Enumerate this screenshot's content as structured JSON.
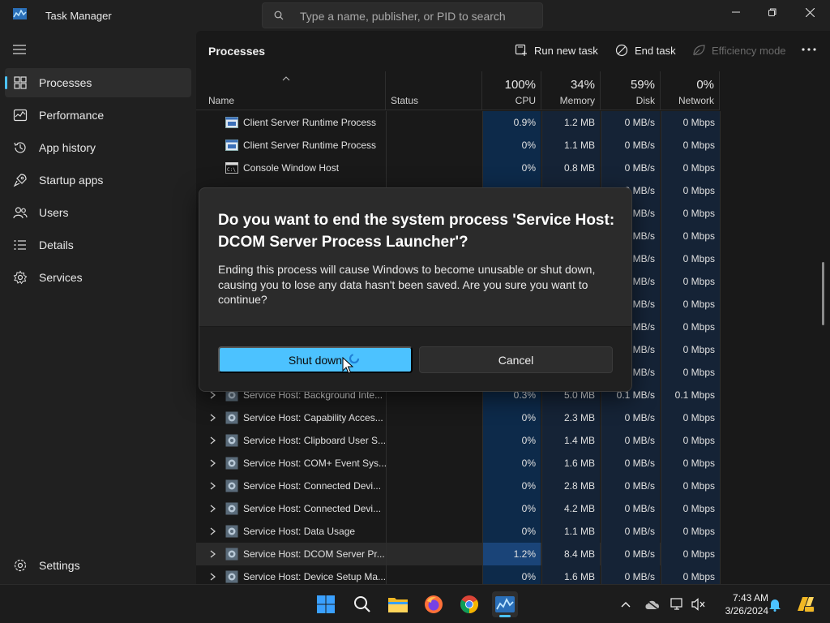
{
  "window": {
    "title": "Task Manager",
    "search_placeholder": "Type a name, publisher, or PID to search"
  },
  "sidebar": {
    "items": [
      {
        "label": "Processes",
        "icon": "processes-icon",
        "active": true
      },
      {
        "label": "Performance",
        "icon": "performance-icon"
      },
      {
        "label": "App history",
        "icon": "app-history-icon"
      },
      {
        "label": "Startup apps",
        "icon": "startup-apps-icon"
      },
      {
        "label": "Users",
        "icon": "users-icon"
      },
      {
        "label": "Details",
        "icon": "details-icon"
      },
      {
        "label": "Services",
        "icon": "services-icon"
      }
    ],
    "settings": "Settings"
  },
  "toolbar": {
    "title": "Processes",
    "run_new_task": "Run new task",
    "end_task": "End task",
    "efficiency_mode": "Efficiency mode"
  },
  "table": {
    "columns": {
      "name": "Name",
      "status": "Status",
      "cpu": {
        "pct": "100%",
        "label": "CPU"
      },
      "memory": {
        "pct": "34%",
        "label": "Memory"
      },
      "disk": {
        "pct": "59%",
        "label": "Disk"
      },
      "network": {
        "pct": "0%",
        "label": "Network"
      }
    },
    "rows": [
      {
        "name": "Client Server Runtime Process",
        "cpu": "0.9%",
        "mem": "1.2 MB",
        "disk": "0 MB/s",
        "net": "0 Mbps",
        "indent": true,
        "icon": "window-icon"
      },
      {
        "name": "Client Server Runtime Process",
        "cpu": "0%",
        "mem": "1.1 MB",
        "disk": "0 MB/s",
        "net": "0 Mbps",
        "indent": true,
        "icon": "window-icon"
      },
      {
        "name": "Console Window Host",
        "cpu": "0%",
        "mem": "0.8 MB",
        "disk": "0 MB/s",
        "net": "0 Mbps",
        "indent": true,
        "icon": "console-icon"
      },
      {
        "name": "",
        "cpu": "",
        "mem": "",
        "disk": "0 MB/s",
        "net": "0 Mbps"
      },
      {
        "name": "",
        "cpu": "",
        "mem": "",
        "disk": "0 MB/s",
        "net": "0 Mbps"
      },
      {
        "name": "",
        "cpu": "",
        "mem": "",
        "disk": "0 MB/s",
        "net": "0 Mbps"
      },
      {
        "name": "",
        "cpu": "",
        "mem": "",
        "disk": "0 MB/s",
        "net": "0 Mbps"
      },
      {
        "name": "",
        "cpu": "",
        "mem": "",
        "disk": "0 MB/s",
        "net": "0 Mbps"
      },
      {
        "name": "",
        "cpu": "",
        "mem": "",
        "disk": "0 MB/s",
        "net": "0 Mbps"
      },
      {
        "name": "",
        "cpu": "",
        "mem": "",
        "disk": "0 MB/s",
        "net": "0 Mbps"
      },
      {
        "name": "",
        "cpu": "",
        "mem": "",
        "disk": "0 MB/s",
        "net": "0 Mbps"
      },
      {
        "name": "",
        "cpu": "",
        "mem": "",
        "disk": "0 MB/s",
        "net": "0 Mbps"
      },
      {
        "name": "Service Host: Background Inte...",
        "cpu": "0.3%",
        "mem": "5.0 MB",
        "disk": "0.1 MB/s",
        "net": "0.1 Mbps",
        "expand": true,
        "icon": "gear-icon"
      },
      {
        "name": "Service Host: Capability Acces...",
        "cpu": "0%",
        "mem": "2.3 MB",
        "disk": "0 MB/s",
        "net": "0 Mbps",
        "expand": true,
        "icon": "gear-icon"
      },
      {
        "name": "Service Host: Clipboard User S...",
        "cpu": "0%",
        "mem": "1.4 MB",
        "disk": "0 MB/s",
        "net": "0 Mbps",
        "expand": true,
        "icon": "gear-icon"
      },
      {
        "name": "Service Host: COM+ Event Sys...",
        "cpu": "0%",
        "mem": "1.6 MB",
        "disk": "0 MB/s",
        "net": "0 Mbps",
        "expand": true,
        "icon": "gear-icon"
      },
      {
        "name": "Service Host: Connected Devi...",
        "cpu": "0%",
        "mem": "2.8 MB",
        "disk": "0 MB/s",
        "net": "0 Mbps",
        "expand": true,
        "icon": "gear-icon"
      },
      {
        "name": "Service Host: Connected Devi...",
        "cpu": "0%",
        "mem": "4.2 MB",
        "disk": "0 MB/s",
        "net": "0 Mbps",
        "expand": true,
        "icon": "gear-icon"
      },
      {
        "name": "Service Host: Data Usage",
        "cpu": "0%",
        "mem": "1.1 MB",
        "disk": "0 MB/s",
        "net": "0 Mbps",
        "expand": true,
        "icon": "gear-icon"
      },
      {
        "name": "Service Host: DCOM Server Pr...",
        "cpu": "1.2%",
        "mem": "8.4 MB",
        "disk": "0 MB/s",
        "net": "0 Mbps",
        "expand": true,
        "icon": "gear-icon",
        "selected": true
      },
      {
        "name": "Service Host: Device Setup Ma...",
        "cpu": "0%",
        "mem": "1.6 MB",
        "disk": "0 MB/s",
        "net": "0 Mbps",
        "expand": true,
        "icon": "gear-icon"
      }
    ]
  },
  "dialog": {
    "title": "Do you want to end the system process 'Service Host: DCOM Server Process Launcher'?",
    "body": "Ending this process will cause Windows to become unusable or shut down, causing you to lose any data hasn't been saved. Are you sure you want to continue?",
    "primary": "Shut down",
    "secondary": "Cancel"
  },
  "taskbar": {
    "time": "7:43 AM",
    "date": "3/26/2024",
    "apps": [
      "windows-start-icon",
      "search-icon",
      "file-explorer-icon",
      "firefox-icon",
      "chrome-icon",
      "task-manager-icon"
    ]
  },
  "colors": {
    "accent": "#4cc2ff",
    "cpu_col": "#0d2a4a",
    "heat_col": "#152336"
  }
}
